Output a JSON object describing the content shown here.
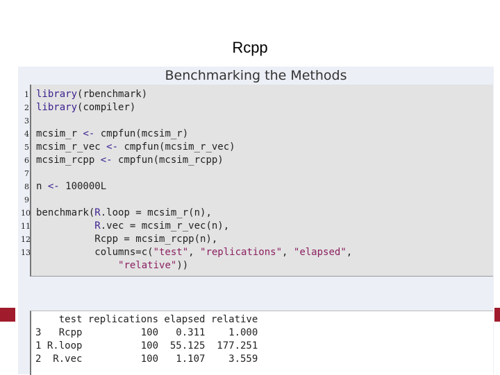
{
  "slide": {
    "title": "Rcpp",
    "accent_color": "#a01c2c"
  },
  "frame": {
    "title": "Benchmarking the Methods"
  },
  "code": [
    {
      "n": "1",
      "segments": [
        {
          "t": "library",
          "c": "kw"
        },
        {
          "t": "(rbenchmark)",
          "c": "plain"
        }
      ]
    },
    {
      "n": "2",
      "segments": [
        {
          "t": "library",
          "c": "kw"
        },
        {
          "t": "(compiler)",
          "c": "plain"
        }
      ]
    },
    {
      "n": "3",
      "segments": []
    },
    {
      "n": "4",
      "segments": [
        {
          "t": "mcsim_r ",
          "c": "plain"
        },
        {
          "t": "<-",
          "c": "kw"
        },
        {
          "t": " cmpfun(mcsim_r)",
          "c": "plain"
        }
      ]
    },
    {
      "n": "5",
      "segments": [
        {
          "t": "mcsim_r_vec ",
          "c": "plain"
        },
        {
          "t": "<-",
          "c": "kw"
        },
        {
          "t": " cmpfun(mcsim_r_vec)",
          "c": "plain"
        }
      ]
    },
    {
      "n": "6",
      "segments": [
        {
          "t": "mcsim_rcpp ",
          "c": "plain"
        },
        {
          "t": "<-",
          "c": "kw"
        },
        {
          "t": " cmpfun(mcsim_rcpp)",
          "c": "plain"
        }
      ]
    },
    {
      "n": "7",
      "segments": []
    },
    {
      "n": "8",
      "segments": [
        {
          "t": "n ",
          "c": "plain"
        },
        {
          "t": "<-",
          "c": "kw"
        },
        {
          "t": " 100000L",
          "c": "plain"
        }
      ]
    },
    {
      "n": "9",
      "segments": []
    },
    {
      "n": "10",
      "segments": [
        {
          "t": "benchmark(",
          "c": "plain"
        },
        {
          "t": "R",
          "c": "kw"
        },
        {
          "t": ".loop = mcsim_r(n),",
          "c": "plain"
        }
      ]
    },
    {
      "n": "11",
      "segments": [
        {
          "t": "          ",
          "c": "plain"
        },
        {
          "t": "R",
          "c": "kw"
        },
        {
          "t": ".vec = mcsim_r_vec(n),",
          "c": "plain"
        }
      ]
    },
    {
      "n": "12",
      "segments": [
        {
          "t": "          Rcpp = mcsim_rcpp(n),",
          "c": "plain"
        }
      ]
    },
    {
      "n": "13",
      "segments": [
        {
          "t": "          columns=c(",
          "c": "plain"
        },
        {
          "t": "\"test\"",
          "c": "str"
        },
        {
          "t": ", ",
          "c": "plain"
        },
        {
          "t": "\"replications\"",
          "c": "str"
        },
        {
          "t": ", ",
          "c": "plain"
        },
        {
          "t": "\"elapsed\"",
          "c": "str"
        },
        {
          "t": ",",
          "c": "plain"
        }
      ]
    },
    {
      "n": "",
      "segments": [
        {
          "t": "              ",
          "c": "plain"
        },
        {
          "t": "\"relative\"",
          "c": "str"
        },
        {
          "t": "))",
          "c": "plain"
        }
      ]
    }
  ],
  "output": [
    "    test replications elapsed relative",
    "3   Rcpp          100   0.311    1.000",
    "1 R.loop          100  55.125  177.251",
    "2  R.vec          100   1.107    3.559"
  ]
}
